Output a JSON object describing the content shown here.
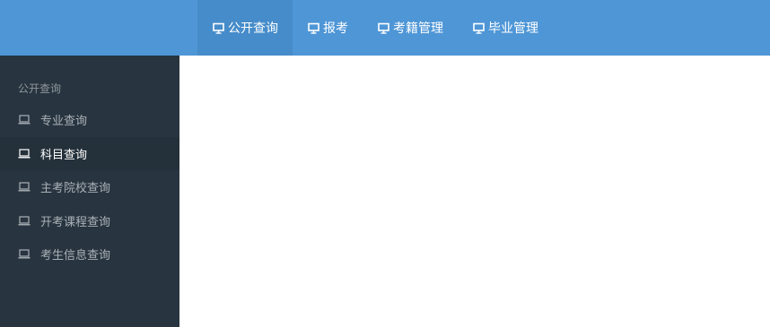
{
  "colors": {
    "topbar": "#4e96d6",
    "topbar_active": "#468cca",
    "sidebar": "#28343f",
    "sidebar_active": "#24303a",
    "sidebar_text": "#aab1b7",
    "sidebar_heading": "#8f969b"
  },
  "topnav": {
    "items": [
      {
        "label": "公开查询",
        "icon": "monitor-icon",
        "active": true
      },
      {
        "label": "报考",
        "icon": "monitor-icon",
        "active": false
      },
      {
        "label": "考籍管理",
        "icon": "monitor-icon",
        "active": false
      },
      {
        "label": "毕业管理",
        "icon": "monitor-icon",
        "active": false
      }
    ]
  },
  "sidebar": {
    "heading": "公开查询",
    "items": [
      {
        "label": "专业查询",
        "icon": "laptop-icon",
        "active": false
      },
      {
        "label": "科目查询",
        "icon": "laptop-icon",
        "active": true
      },
      {
        "label": "主考院校查询",
        "icon": "laptop-icon",
        "active": false
      },
      {
        "label": "开考课程查询",
        "icon": "laptop-icon",
        "active": false
      },
      {
        "label": "考生信息查询",
        "icon": "laptop-icon",
        "active": false
      }
    ]
  }
}
